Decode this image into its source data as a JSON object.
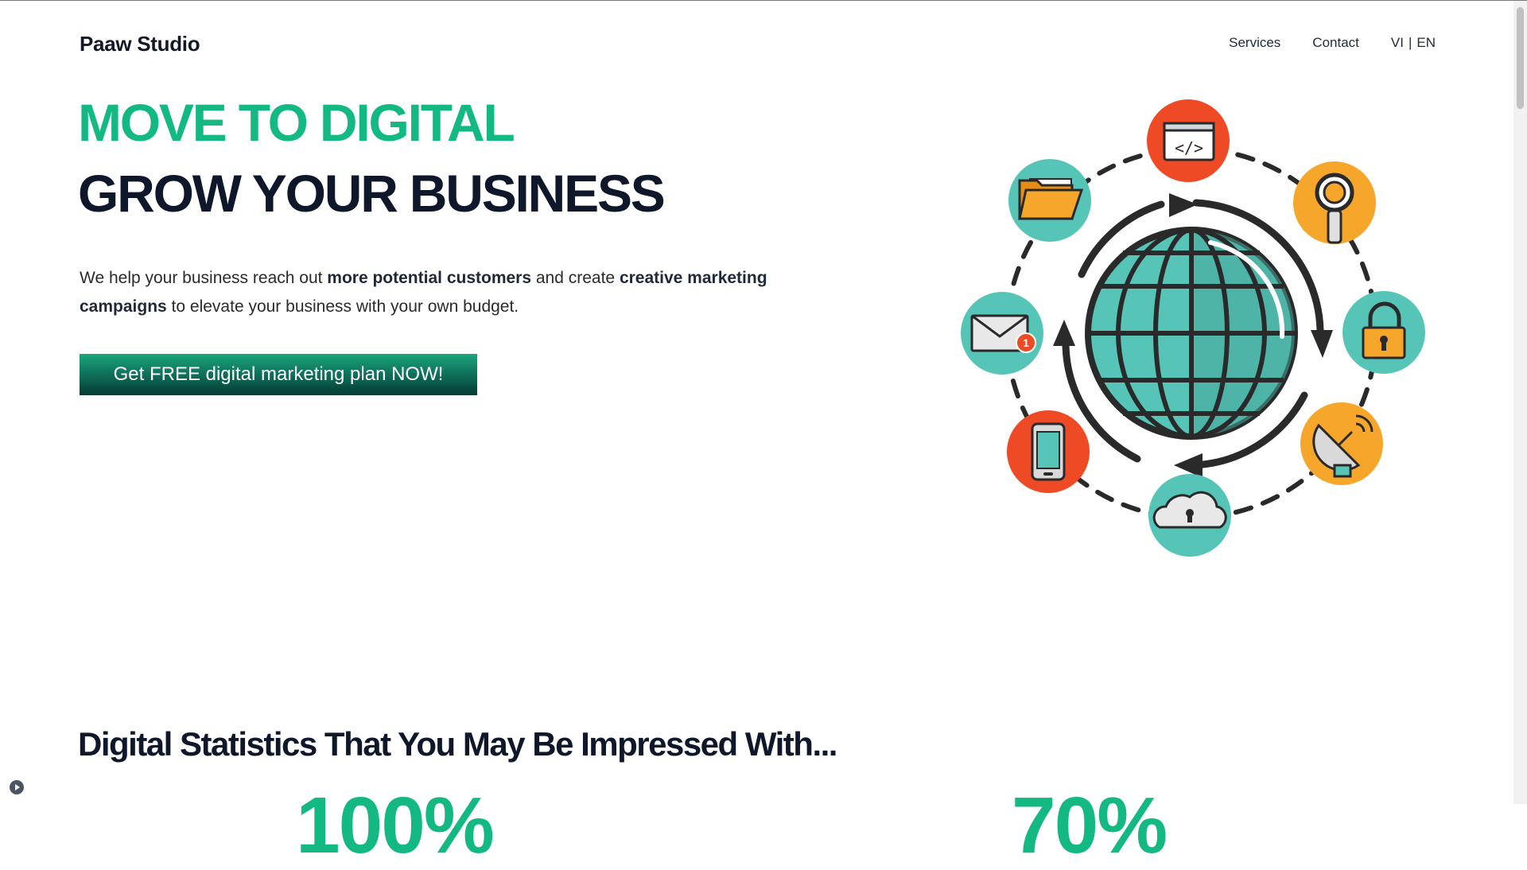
{
  "header": {
    "logo": "Paaw Studio",
    "nav": {
      "services": "Services",
      "contact": "Contact"
    },
    "lang": {
      "vi": "VI",
      "separator": "|",
      "en": "EN"
    }
  },
  "hero": {
    "headline_1": "MOVE TO DIGITAL",
    "headline_2": "GROW YOUR BUSINESS",
    "lead": {
      "part1": "We help your business reach out ",
      "bold1": "more potential customers",
      "part2": " and create ",
      "bold2": "creative marketing campaigns",
      "part3": " to elevate your business with your own budget."
    },
    "cta_label": "Get FREE digital marketing plan NOW!",
    "illustration": {
      "icons": [
        "code-window-icon",
        "magnifier-icon",
        "padlock-icon",
        "satellite-dish-icon",
        "cloud-lock-icon",
        "smartphone-icon",
        "mail-icon",
        "folder-icon",
        "globe-icon"
      ],
      "mail_badge": "1",
      "code_glyph": "</>"
    }
  },
  "stats": {
    "title": "Digital Statistics That You May Be Impressed With...",
    "numbers": [
      "100%",
      "70%"
    ]
  },
  "colors": {
    "accent_green": "#14b882",
    "heading_dark": "#0f172a",
    "teal": "#56c5b8",
    "orange_red": "#ef4a26",
    "orange": "#f6a72b"
  }
}
